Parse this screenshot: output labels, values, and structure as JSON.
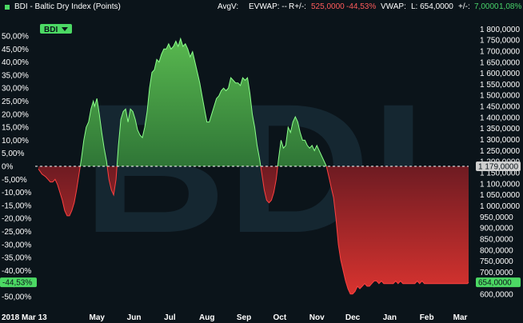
{
  "header": {
    "title": "BDI - Baltic Dry Index (Points)",
    "avgv_label": "AvgV:",
    "evwap_label": "EVWAP: --",
    "change_label": "R+/-:",
    "change_value": "525,0000",
    "change_pct": "-44,53%",
    "vwap_label": "VWAP:",
    "last_label": "L: 654,0000",
    "delta_label": "+/-:",
    "delta_value": "7,0000",
    "delta_pct": "1,08%",
    "colors": {
      "up": "#48d36a",
      "down": "#ff5b5b",
      "square": "#4cd964"
    }
  },
  "watermark": "BDI",
  "legend_badge": "BDI",
  "chart_data": {
    "type": "area",
    "title": "BDI - Baltic Dry Index (Points)",
    "reference_value": 1179,
    "reference_label": "1 179,0000",
    "last_value_label": "654,0000",
    "last_pct_label": "-44,53%",
    "y_left_ticks": [
      "50,00%",
      "45,00%",
      "40,00%",
      "35,00%",
      "30,00%",
      "25,00%",
      "20,00%",
      "15,00%",
      "10,00%",
      "5,00%",
      "0%",
      "-5,00%",
      "-10,00%",
      "-15,00%",
      "-20,00%",
      "-25,00%",
      "-30,00%",
      "-35,00%",
      "-40,00%",
      "-45,00%",
      "-50,00%"
    ],
    "y_left_values": [
      50,
      45,
      40,
      35,
      30,
      25,
      20,
      15,
      10,
      5,
      0,
      -5,
      -10,
      -15,
      -20,
      -25,
      -30,
      -35,
      -40,
      -45,
      -50
    ],
    "y_right_ticks": [
      "1 800,0000",
      "1 750,0000",
      "1 700,0000",
      "1 650,0000",
      "1 600,0000",
      "1 550,0000",
      "1 500,0000",
      "1 450,0000",
      "1 400,0000",
      "1 350,0000",
      "1 300,0000",
      "1 250,0000",
      "1 200,0000",
      "1 150,0000",
      "1 100,0000",
      "1 050,0000",
      "1 000,0000",
      "950,0000",
      "900,0000",
      "850,0000",
      "800,0000",
      "750,0000",
      "700,0000",
      "650,0000",
      "600,0000"
    ],
    "y_right_values": [
      1800,
      1750,
      1700,
      1650,
      1600,
      1550,
      1500,
      1450,
      1400,
      1350,
      1300,
      1250,
      1200,
      1150,
      1100,
      1050,
      1000,
      950,
      900,
      850,
      800,
      750,
      700,
      650,
      600
    ],
    "x_ticks": [
      {
        "label": "2018 Mar 13",
        "day": 0
      },
      {
        "label": "May",
        "day": 49
      },
      {
        "label": "Jun",
        "day": 80
      },
      {
        "label": "Jul",
        "day": 110
      },
      {
        "label": "Aug",
        "day": 141
      },
      {
        "label": "Sep",
        "day": 172
      },
      {
        "label": "Oct",
        "day": 202
      },
      {
        "label": "Nov",
        "day": 233
      },
      {
        "label": "Dec",
        "day": 263
      },
      {
        "label": "Jan",
        "day": 294
      },
      {
        "label": "Feb",
        "day": 325
      },
      {
        "label": "Mar",
        "day": 353
      }
    ],
    "series": [
      {
        "x": [
          0,
          3,
          6,
          8,
          10,
          12,
          14,
          16,
          18,
          20,
          22,
          24,
          26,
          28,
          30,
          32,
          34,
          36,
          38,
          40,
          42,
          44,
          46,
          47,
          49,
          51,
          53,
          55,
          57,
          59,
          61,
          63,
          65,
          67,
          69,
          71,
          73,
          75,
          77,
          79,
          81,
          83,
          85,
          87,
          89,
          91,
          93,
          95,
          97,
          99,
          101,
          103,
          105,
          107,
          109,
          111,
          113,
          115,
          117,
          119,
          121,
          123,
          125,
          127,
          129,
          131,
          133,
          135,
          137,
          139,
          141,
          143,
          145,
          147,
          149,
          151,
          153,
          155,
          157,
          159,
          161,
          163,
          165,
          167,
          169,
          171,
          173,
          175,
          177,
          179,
          181,
          183,
          185,
          187,
          189,
          191,
          193,
          195,
          197,
          199,
          201,
          203,
          205,
          207,
          209,
          211,
          213,
          215,
          217,
          219,
          221,
          223,
          225,
          227,
          229,
          231,
          233,
          235,
          237,
          239,
          241,
          243,
          245,
          247,
          249,
          251,
          253,
          255,
          257,
          259,
          261,
          263,
          265,
          267,
          269,
          271,
          273,
          275,
          277,
          279,
          281,
          283,
          285,
          287,
          289,
          291,
          293,
          295,
          297,
          299,
          301,
          303,
          305,
          307,
          309,
          311,
          313,
          315,
          317,
          319,
          321,
          323,
          325,
          327,
          329,
          331,
          333,
          335,
          337,
          339,
          341,
          343,
          345,
          347,
          349,
          351,
          353,
          355,
          357,
          359,
          360
        ],
        "values": [
          -1,
          -3,
          -4,
          -5,
          -6,
          -6,
          -5,
          -7,
          -10,
          -13,
          -17,
          -19,
          -19,
          -17,
          -14,
          -9,
          -3,
          3,
          10,
          15,
          17,
          22,
          25,
          23,
          26,
          20,
          13,
          7,
          2,
          -5,
          -9,
          -11,
          -5,
          8,
          18,
          21,
          22,
          17,
          22,
          21,
          18,
          14,
          12,
          11,
          15,
          21,
          30,
          36,
          37,
          41,
          40,
          43,
          45,
          45,
          47,
          45,
          46,
          48,
          46,
          49,
          46,
          47,
          45,
          42,
          44,
          40,
          36,
          32,
          27,
          22,
          17,
          17,
          20,
          23,
          26,
          27,
          29,
          30,
          29,
          30,
          34,
          33,
          32,
          32,
          31,
          34,
          33,
          34,
          28,
          20,
          15,
          8,
          3,
          -3,
          -9,
          -13,
          -14,
          -13,
          -10,
          -5,
          3,
          10,
          7,
          8,
          15,
          13,
          17,
          19,
          17,
          13,
          10,
          10,
          8,
          7,
          8,
          6,
          8,
          6,
          4,
          2,
          0,
          -4,
          -8,
          -12,
          -20,
          -30,
          -36,
          -40,
          -44,
          -47,
          -49,
          -49,
          -48,
          -46,
          -47,
          -46,
          -45,
          -46,
          -46,
          -45,
          -44,
          -44,
          -45,
          -44,
          -45,
          -45,
          -45,
          -45,
          -45,
          -44,
          -45,
          -44,
          -45,
          -45,
          -45,
          -45,
          -45,
          -45,
          -44,
          -45,
          -44,
          -45,
          -45,
          -45,
          -45,
          -45,
          -45,
          -45,
          -45,
          -45,
          -45,
          -45,
          -45,
          -45,
          -45,
          -45,
          -45,
          -45,
          -45,
          -45,
          -44.5
        ]
      }
    ],
    "ylim": [
      -50,
      50
    ],
    "xlim": [
      0,
      360
    ],
    "grid": false,
    "legend": "top-left"
  }
}
